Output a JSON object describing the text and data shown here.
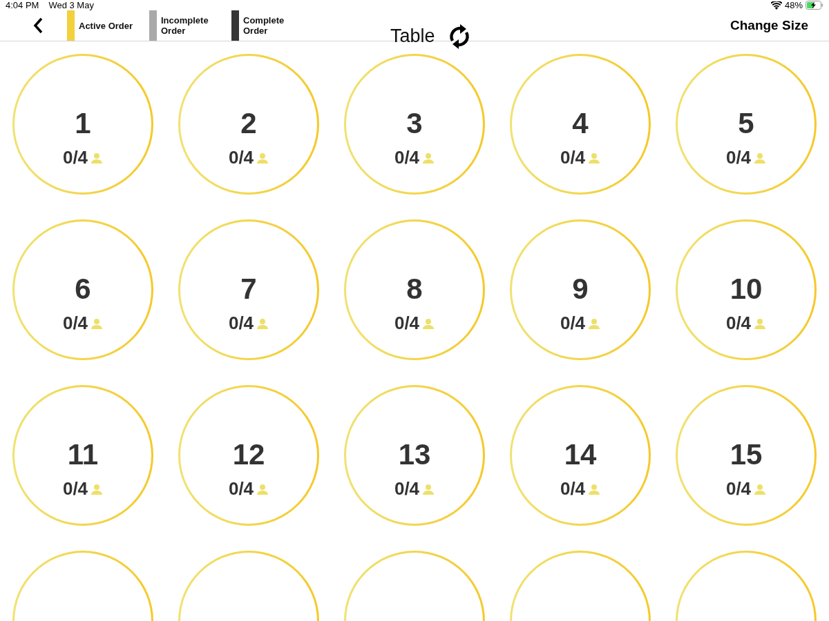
{
  "status_bar": {
    "time": "4:04 PM",
    "date": "Wed 3 May",
    "battery": "48%"
  },
  "header": {
    "title": "Table",
    "action": "Change Size",
    "legend": [
      {
        "label": "Active Order",
        "color": "#f3d03e"
      },
      {
        "label": "Incomplete Order",
        "color": "#a9a9a9"
      },
      {
        "label": "Complete Order",
        "color": "#363636"
      }
    ]
  },
  "tables": [
    {
      "kind": "table",
      "number": "1",
      "seats": "0/4"
    },
    {
      "kind": "table",
      "number": "2",
      "seats": "0/4"
    },
    {
      "kind": "table",
      "number": "3",
      "seats": "0/4"
    },
    {
      "kind": "table",
      "number": "4",
      "seats": "0/4"
    },
    {
      "kind": "table",
      "number": "5",
      "seats": "0/4"
    },
    {
      "kind": "table",
      "number": "6",
      "seats": "0/4"
    },
    {
      "kind": "table",
      "number": "7",
      "seats": "0/4"
    },
    {
      "kind": "table",
      "number": "8",
      "seats": "0/4"
    },
    {
      "kind": "table",
      "number": "9",
      "seats": "0/4"
    },
    {
      "kind": "table",
      "number": "10",
      "seats": "0/4"
    },
    {
      "kind": "table",
      "number": "11",
      "seats": "0/4"
    },
    {
      "kind": "table",
      "number": "12",
      "seats": "0/4"
    },
    {
      "kind": "table",
      "number": "13",
      "seats": "0/4"
    },
    {
      "kind": "table",
      "number": "14",
      "seats": "0/4"
    },
    {
      "kind": "table",
      "number": "15",
      "seats": "0/4"
    },
    {
      "kind": "cut-off"
    },
    {
      "kind": "cut-off"
    },
    {
      "kind": "cut-off"
    },
    {
      "kind": "cut-off"
    },
    {
      "kind": "cut-off"
    }
  ]
}
